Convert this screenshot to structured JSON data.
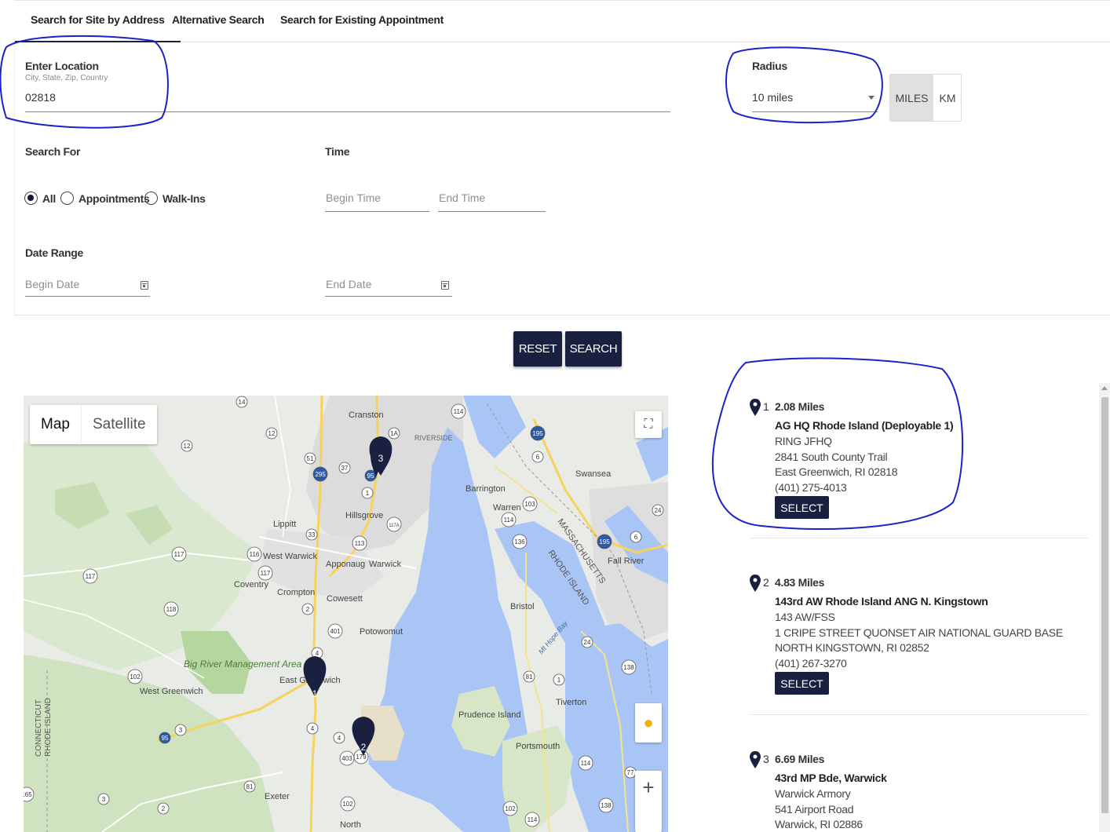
{
  "tabs": [
    {
      "label": "Search for Site by Address"
    },
    {
      "label": "Alternative Search"
    },
    {
      "label": "Search for Existing Appointment"
    }
  ],
  "location": {
    "label": "Enter Location",
    "hint": "City, State, Zip, Country",
    "value": "02818"
  },
  "radius": {
    "label": "Radius",
    "value": "10 miles",
    "units": [
      "MILES",
      "KM"
    ],
    "selected_unit": "MILES"
  },
  "search_for": {
    "label": "Search For",
    "options": [
      "All",
      "Appointments",
      "Walk-Ins"
    ],
    "selected": "All"
  },
  "time": {
    "label": "Time",
    "begin_placeholder": "Begin Time",
    "end_placeholder": "End Time"
  },
  "date_range": {
    "label": "Date Range",
    "begin_placeholder": "Begin Date",
    "end_placeholder": "End Date"
  },
  "buttons": {
    "reset": "RESET",
    "search": "SEARCH"
  },
  "map": {
    "toggle": {
      "map": "Map",
      "satellite": "Satellite"
    },
    "places": [
      "Cranston",
      "RIVERSIDE",
      "Swansea",
      "Barrington",
      "Warren",
      "Hillsgrove",
      "Lippitt",
      "West Warwick",
      "Apponaug",
      "Warwick",
      "Fall River",
      "Coventry",
      "Crompton",
      "Cowesett",
      "Bristol",
      "MASSACHUSETTS",
      "RHODE ISLAND",
      "Mt Hope Bay",
      "Potowomut",
      "Big River Management Area",
      "East Greenwich",
      "West Greenwich",
      "Tiverton",
      "Prudence Island",
      "Portsmouth",
      "Exeter",
      "North",
      "CONNECTICUT",
      "RHODE ISLAND"
    ],
    "markers": [
      "1",
      "2",
      "3"
    ],
    "routes": [
      "14",
      "12",
      "12",
      "51",
      "37",
      "295",
      "95",
      "1",
      "1A",
      "114",
      "195",
      "6",
      "103",
      "114",
      "24",
      "136",
      "195",
      "6",
      "113",
      "117A",
      "33",
      "116",
      "117",
      "117",
      "4",
      "118",
      "2",
      "401",
      "117",
      "4",
      "102",
      "95",
      "3",
      "4",
      "403",
      "1",
      "24",
      "138",
      "81",
      "114",
      "77",
      "81",
      "102",
      "2",
      "3",
      "165",
      "102",
      "114",
      "138",
      "179"
    ]
  },
  "results": [
    {
      "num": "1",
      "distance": "2.08 Miles",
      "name": "AG HQ Rhode Island (Deployable 1)",
      "lines": [
        "RING JFHQ",
        "2841 South County Trail",
        "East Greenwich, RI 02818",
        "(401) 275-4013"
      ],
      "button": "SELECT"
    },
    {
      "num": "2",
      "distance": "4.83 Miles",
      "name": "143rd AW Rhode Island ANG N. Kingstown",
      "lines": [
        "143 AW/FSS",
        "1 CRIPE STREET QUONSET AIR NATIONAL GUARD BASE",
        "NORTH KINGSTOWN, RI 02852",
        "(401) 267-3270"
      ],
      "button": "SELECT"
    },
    {
      "num": "3",
      "distance": "6.69 Miles",
      "name": "43rd MP Bde, Warwick",
      "lines": [
        "Warwick Armory",
        "541 Airport Road",
        "Warwick, RI 02886"
      ]
    }
  ],
  "colors": {
    "primary": "#1a2040",
    "water": "#a8c5f5",
    "annotation": "#1c22c8"
  }
}
